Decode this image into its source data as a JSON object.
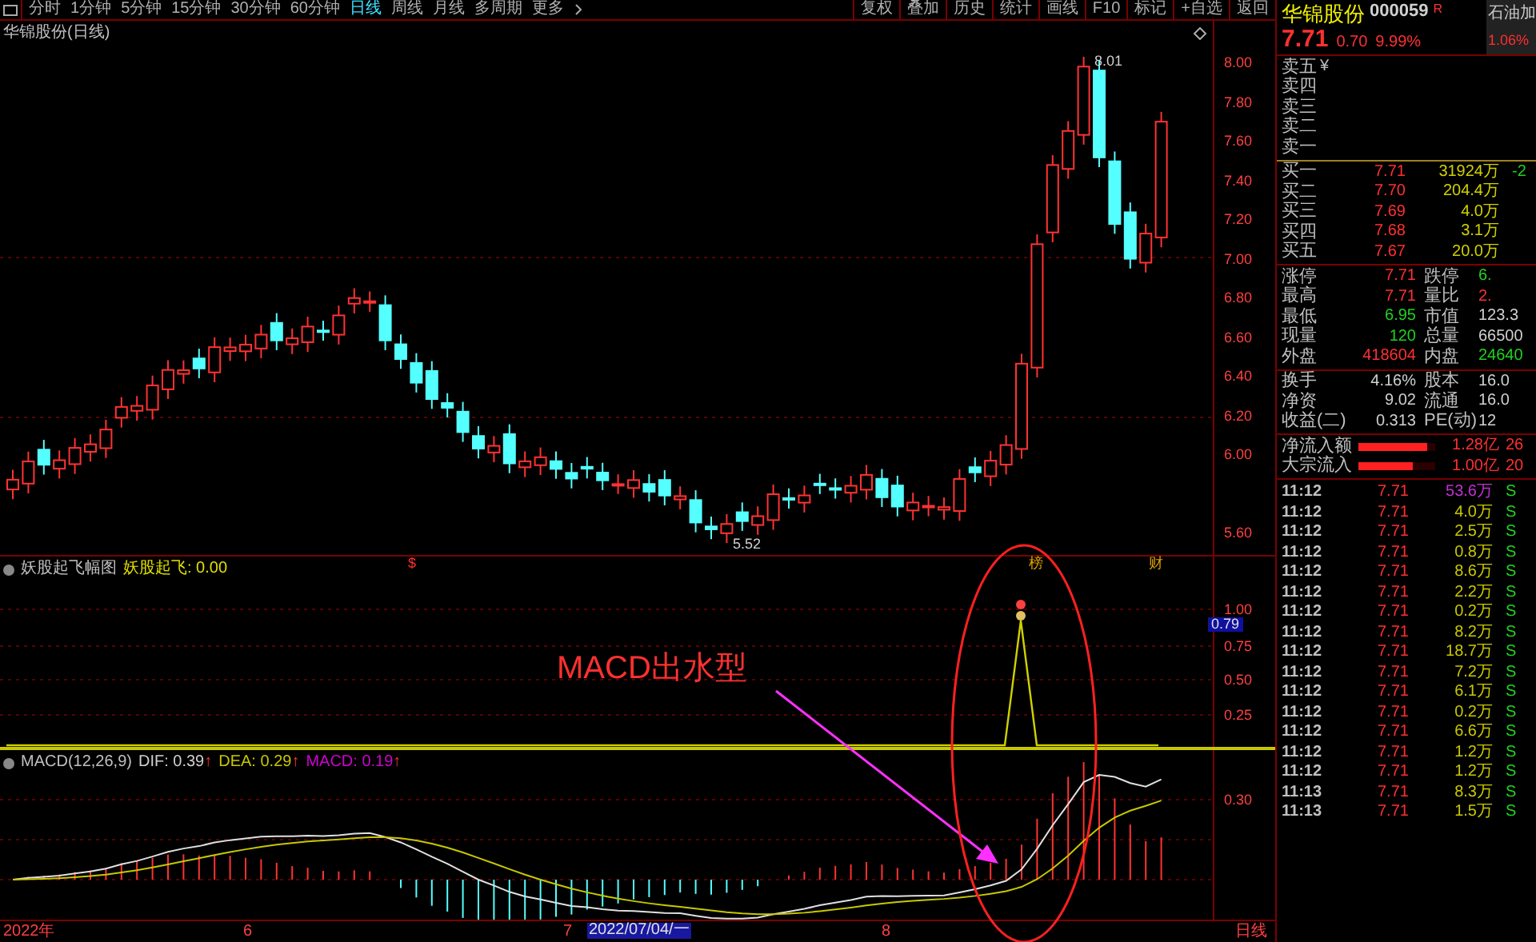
{
  "toolbar": {
    "periods": [
      {
        "label": "分时",
        "selected": false
      },
      {
        "label": "1分钟",
        "selected": false
      },
      {
        "label": "5分钟",
        "selected": false
      },
      {
        "label": "15分钟",
        "selected": false
      },
      {
        "label": "30分钟",
        "selected": false
      },
      {
        "label": "60分钟",
        "selected": false
      },
      {
        "label": "日线",
        "selected": true
      },
      {
        "label": "周线",
        "selected": false
      },
      {
        "label": "月线",
        "selected": false
      },
      {
        "label": "多周期",
        "selected": false
      },
      {
        "label": "更多",
        "selected": false
      }
    ],
    "actions": [
      "复权",
      "叠加",
      "历史",
      "统计",
      "画线",
      "F10",
      "标记",
      "+自选",
      "返回"
    ]
  },
  "main_chart": {
    "title": "华锦股份(日线)",
    "high_label": "8.01",
    "low_label": "5.52",
    "yticks": [
      "8.00",
      "7.80",
      "7.60",
      "7.40",
      "7.20",
      "7.00",
      "6.80",
      "6.60",
      "6.40",
      "6.20",
      "6.00",
      "5.60"
    ],
    "event_marks": [
      "$",
      "榜",
      "财"
    ]
  },
  "indicator": {
    "title": "妖股起飞幅图",
    "reading": "妖股起飞: 0.00",
    "yticks": [
      "1.00",
      "0.75",
      "0.50",
      "0.25"
    ],
    "value_badge": "0.79"
  },
  "macd": {
    "title": "MACD(12,26,9)",
    "items": [
      {
        "text": "DIF: 0.39",
        "arrow": "↑",
        "color": "#d0d0d0"
      },
      {
        "text": "DEA: 0.29",
        "arrow": "↑",
        "color": "#c8c800"
      },
      {
        "text": "MACD: 0.19",
        "arrow": "↑",
        "color": "#d000d0"
      }
    ],
    "ytick": "0.30"
  },
  "time_axis": [
    {
      "label": "2022年",
      "kind": "date"
    },
    {
      "label": "6",
      "kind": "date"
    },
    {
      "label": "7",
      "kind": "date"
    },
    {
      "label": "2022/07/04/一",
      "kind": "cursor"
    },
    {
      "label": "8",
      "kind": "date"
    },
    {
      "label": "日线",
      "kind": "date"
    }
  ],
  "annotation": {
    "text": "MACD出水型"
  },
  "quote": {
    "name": "华锦股份",
    "code": "000059",
    "flag": "R",
    "price": "7.71",
    "change": "0.70",
    "change_pct": "9.99%",
    "sector": {
      "name": "石油加",
      "change": "1.06%"
    },
    "asks": [
      {
        "label": "卖五",
        "note": "¥"
      },
      {
        "label": "卖四"
      },
      {
        "label": "卖三"
      },
      {
        "label": "卖二"
      },
      {
        "label": "卖一"
      }
    ],
    "bids": [
      {
        "label": "买一",
        "price": "7.71",
        "volume": "31924万",
        "column_4": "-2"
      },
      {
        "label": "买二",
        "price": "7.70",
        "volume": "204.4万"
      },
      {
        "label": "买三",
        "price": "7.69",
        "volume": "4.0万"
      },
      {
        "label": "买四",
        "price": "7.68",
        "volume": "3.1万"
      },
      {
        "label": "买五",
        "price": "7.67",
        "volume": "20.0万"
      }
    ],
    "stats": [
      {
        "label": "涨停",
        "value": "7.71",
        "color": "#ff3030"
      },
      {
        "label": "跌停",
        "value": "6.",
        "color": "#20d020"
      },
      {
        "label": "最高",
        "value": "7.71",
        "color": "#ff3030"
      },
      {
        "label": "量比",
        "value": "2.",
        "color": "#ff3030"
      },
      {
        "label": "最低",
        "value": "6.95",
        "color": "#20d020"
      },
      {
        "label": "市值",
        "value": "123.3",
        "color": "#d0d0d0"
      },
      {
        "label": "现量",
        "value": "120",
        "color": "#20d020"
      },
      {
        "label": "总量",
        "value": "66500",
        "color": "#d0d0d0"
      },
      {
        "label": "外盘",
        "value": "418604",
        "color": "#ff3030"
      },
      {
        "label": "内盘",
        "value": "24640",
        "color": "#20d020"
      }
    ],
    "finance": [
      {
        "label": "换手",
        "value": "4.16%"
      },
      {
        "label": "股本",
        "value": "16.0"
      },
      {
        "label": "净资",
        "value": "9.02"
      },
      {
        "label": "流通",
        "value": "16.0"
      },
      {
        "label": "收益(二)",
        "value": "0.313"
      },
      {
        "label": "PE(动)",
        "value": "12"
      }
    ],
    "flows": [
      {
        "label": "净流入额",
        "level": 0.9,
        "value": "1.28亿",
        "extra": "26"
      },
      {
        "label": "大宗流入",
        "level": 0.7,
        "value": "1.00亿",
        "extra": "20"
      }
    ],
    "trades": [
      {
        "time": "11:12",
        "price": "7.71",
        "volume": "53.6万",
        "color": "#c030d0",
        "side": "S"
      },
      {
        "time": "11:12",
        "price": "7.71",
        "volume": "4.0万",
        "color": "#c8c800",
        "side": "S"
      },
      {
        "time": "11:12",
        "price": "7.71",
        "volume": "2.5万",
        "color": "#c8c800",
        "side": "S"
      },
      {
        "time": "11:12",
        "price": "7.71",
        "volume": "0.8万",
        "color": "#c8c800",
        "side": "S"
      },
      {
        "time": "11:12",
        "price": "7.71",
        "volume": "8.6万",
        "color": "#c8c800",
        "side": "S"
      },
      {
        "time": "11:12",
        "price": "7.71",
        "volume": "2.2万",
        "color": "#c8c800",
        "side": "S"
      },
      {
        "time": "11:12",
        "price": "7.71",
        "volume": "0.2万",
        "color": "#c8c800",
        "side": "S"
      },
      {
        "time": "11:12",
        "price": "7.71",
        "volume": "8.2万",
        "color": "#c8c800",
        "side": "S"
      },
      {
        "time": "11:12",
        "price": "7.71",
        "volume": "18.7万",
        "color": "#c8c800",
        "side": "S"
      },
      {
        "time": "11:12",
        "price": "7.71",
        "volume": "7.2万",
        "color": "#c8c800",
        "side": "S"
      },
      {
        "time": "11:12",
        "price": "7.71",
        "volume": "6.1万",
        "color": "#c8c800",
        "side": "S"
      },
      {
        "time": "11:12",
        "price": "7.71",
        "volume": "0.2万",
        "color": "#c8c800",
        "side": "S"
      },
      {
        "time": "11:12",
        "price": "7.71",
        "volume": "6.6万",
        "color": "#c8c800",
        "side": "S"
      },
      {
        "time": "11:12",
        "price": "7.71",
        "volume": "1.2万",
        "color": "#c8c800",
        "side": "S"
      },
      {
        "time": "11:12",
        "price": "7.71",
        "volume": "1.2万",
        "color": "#c8c800",
        "side": "S"
      },
      {
        "time": "11:13",
        "price": "7.71",
        "volume": "8.3万",
        "color": "#c8c800",
        "side": "S"
      },
      {
        "time": "11:13",
        "price": "7.71",
        "volume": "1.5万",
        "color": "#c8c800",
        "side": "S"
      }
    ]
  }
}
